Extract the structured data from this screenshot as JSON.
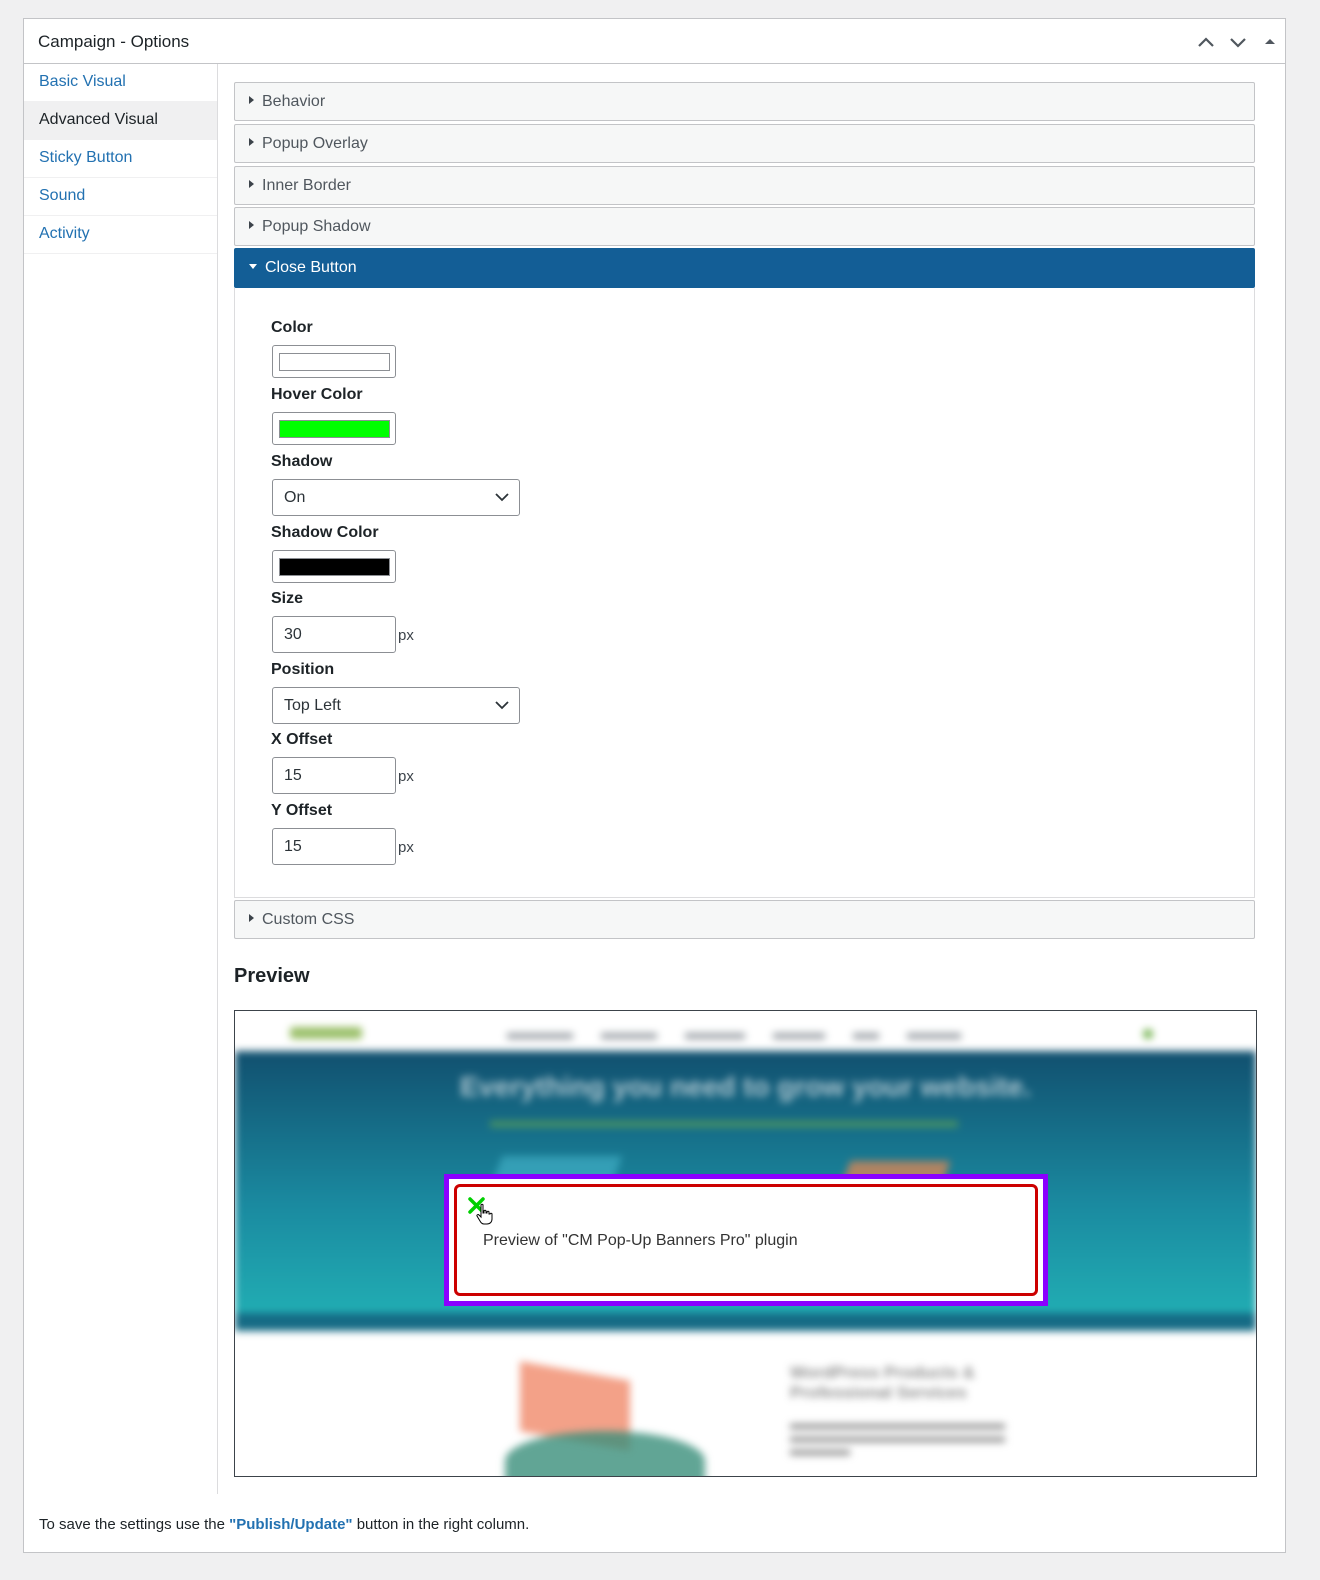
{
  "panel": {
    "title": "Campaign - Options",
    "move_up_icon": "chevron-up-icon",
    "move_down_icon": "chevron-down-icon",
    "toggle_icon": "triangle-up-icon"
  },
  "sidebar": {
    "items": [
      {
        "label": "Basic Visual"
      },
      {
        "label": "Advanced Visual"
      },
      {
        "label": "Sticky Button"
      },
      {
        "label": "Sound"
      },
      {
        "label": "Activity"
      }
    ]
  },
  "accordion": {
    "behavior": "Behavior",
    "popup_overlay": "Popup Overlay",
    "inner_border": "Inner Border",
    "popup_shadow": "Popup Shadow",
    "close_button": "Close Button",
    "custom_css": "Custom CSS"
  },
  "close_button": {
    "color_label": "Color",
    "color_value": "#ffffff",
    "hover_color_label": "Hover Color",
    "hover_color_value": "#00ff00",
    "shadow_label": "Shadow",
    "shadow_value": "On",
    "shadow_color_label": "Shadow Color",
    "shadow_color_value": "#000000",
    "size_label": "Size",
    "size_value": "30",
    "size_unit": "px",
    "position_label": "Position",
    "position_value": "Top Left",
    "x_offset_label": "X Offset",
    "x_offset_value": "15",
    "x_offset_unit": "px",
    "y_offset_label": "Y Offset",
    "y_offset_value": "15",
    "y_offset_unit": "px"
  },
  "preview": {
    "title": "Preview",
    "headline": "Everything you need to grow your website.",
    "popup_text": "Preview of \"CM Pop-Up Banners Pro\" plugin",
    "close_icon": "close-x-icon",
    "cursor_icon": "hand-pointer-icon",
    "popup_border_color": "#cc0000",
    "popup_shadow_color": "#8a00ff",
    "site_section_title": "WordPress Products & Professional Services"
  },
  "footer": {
    "before": "To save the settings use the ",
    "highlight": "\"Publish/Update\"",
    "after": " button in the right column."
  },
  "colors": {
    "accent": "#135e96",
    "link": "#2271b1"
  }
}
